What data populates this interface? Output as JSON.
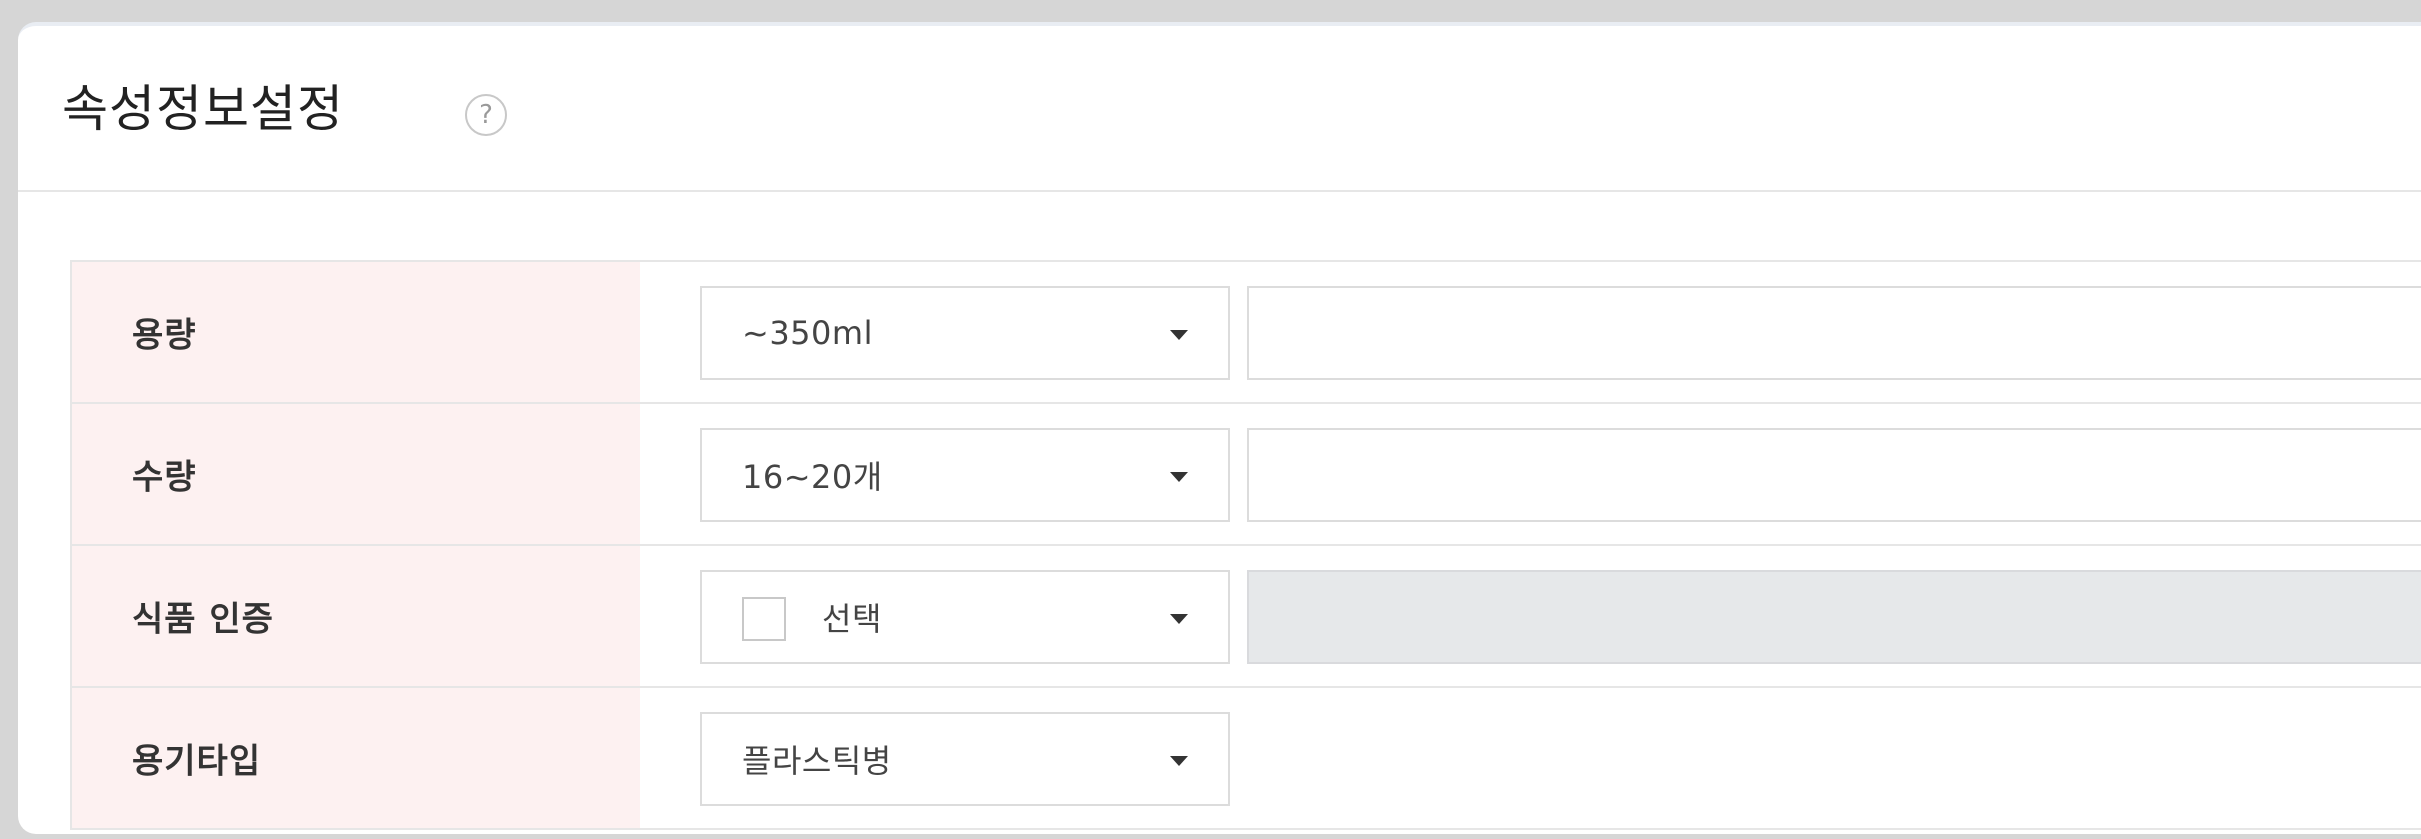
{
  "header": {
    "title": "속성정보설정",
    "help_icon": "?"
  },
  "rows": [
    {
      "label": "용량",
      "select_value": "~350ml",
      "has_checkbox": false,
      "extra_input": "enabled"
    },
    {
      "label": "수량",
      "select_value": "16~20개",
      "has_checkbox": false,
      "extra_input": "enabled"
    },
    {
      "label": "식품 인증",
      "select_value": "선택",
      "has_checkbox": true,
      "extra_input": "disabled"
    },
    {
      "label": "용기타입",
      "select_value": "플라스틱병",
      "has_checkbox": false,
      "extra_input": "none"
    }
  ],
  "icons": {
    "help": "help-icon",
    "dropdown": "chevron-down-icon"
  },
  "colors": {
    "label_bg": "#fdf1f1",
    "disabled_input_bg": "#e6e8ea",
    "page_bg": "#d6d6d6"
  }
}
